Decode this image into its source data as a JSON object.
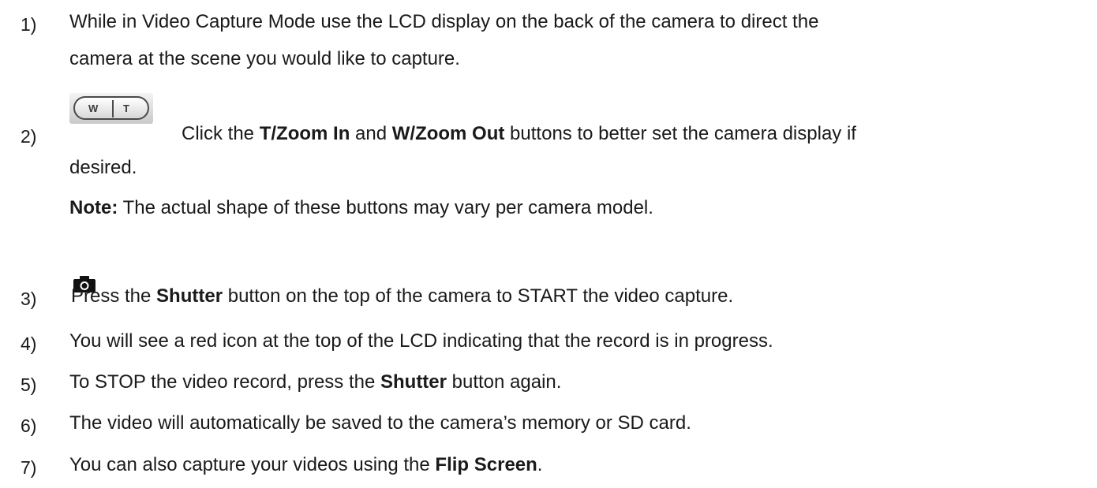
{
  "steps": [
    {
      "num": "1)",
      "line1": "While in Video Capture Mode use the LCD display on the back of the camera to direct the",
      "line2": "camera at the scene you would like to capture."
    },
    {
      "num": "2)",
      "zoom_button": {
        "w_label": "W",
        "t_label": "T"
      },
      "pre1": "Click the ",
      "bold1": "T/Zoom In",
      "mid1": " and ",
      "bold2": "W/Zoom Out",
      "post1": " buttons to better set the camera display if",
      "line2": "desired.",
      "note_label": "Note:",
      "note_text": " The actual shape of these buttons may vary per camera model."
    },
    {
      "num": "3)",
      "icon": "camera-icon",
      "pre": "Press the ",
      "bold": "Shutter",
      "post": " button on the top of the camera to START the video capture."
    },
    {
      "num": "4)",
      "text": "You will see a red icon at the top of the LCD indicating that the record is in progress."
    },
    {
      "num": "5)",
      "pre": "To STOP the video record, press the ",
      "bold": "Shutter",
      "post": " button again."
    },
    {
      "num": "6)",
      "text": "The video will automatically be saved to the camera’s memory or SD card."
    },
    {
      "num": "7)",
      "pre": "You can also capture your videos using the ",
      "bold": "Flip Screen",
      "post": "."
    }
  ]
}
